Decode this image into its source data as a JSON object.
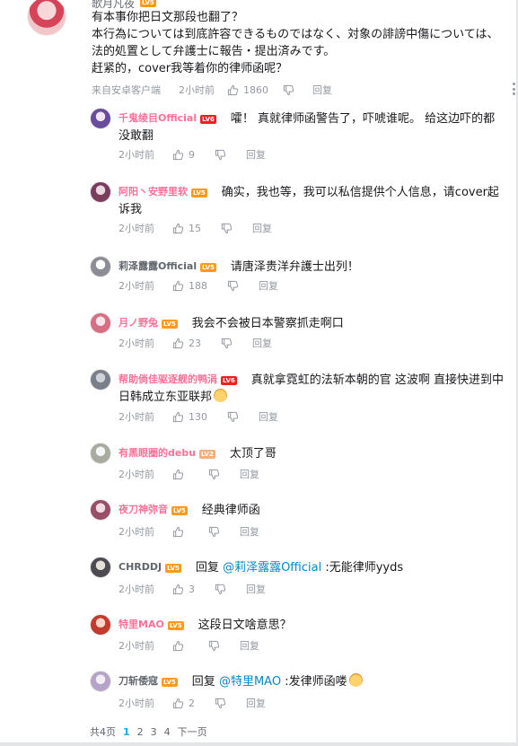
{
  "main_comment": {
    "username": "歌月凡夜",
    "level": "LV5",
    "lines": [
      "有本事你把日文那段也翻了？",
      "本行為については到底許容できるものではなく、対象の誹謗中傷については、",
      "法的処置として弁護士に報告・提出済みです。",
      "赶紧的，cover我等着你的律师函呢？"
    ],
    "source": "来自安卓客户端",
    "time": "2小时前",
    "likes": "1860",
    "reply_label": "回复"
  },
  "replies": [
    {
      "username": "千鬼绫目Official",
      "level": "LV6",
      "text": "嚯！ 真就律师函警告了，吓唬谁呢。 给这边吓的都没敢翻",
      "time": "2小时前",
      "likes": "9",
      "reply_label": "回复"
    },
    {
      "username": "阿阳丶安野里软",
      "level": "LV5",
      "text": "确实，我也等，我可以私信提供个人信息，请cover起诉我",
      "time": "2小时前",
      "likes": "15",
      "reply_label": "回复"
    },
    {
      "username": "莉泽露露Official",
      "level": "LV5",
      "text": "请唐泽贵洋弁護士出列！",
      "time": "2小时前",
      "likes": "188",
      "reply_label": "回复"
    },
    {
      "username": "月ノ野兔",
      "level": "LV5",
      "text": "我会不会被日本警察抓走啊口",
      "time": "2小时前",
      "likes": "23",
      "reply_label": "回复"
    },
    {
      "username": "帮助倘佳驱逐舰的鸭涓",
      "level": "LV6",
      "text": "真就拿霓虹的法斩本朝的官 这波啊 直接快进到中日韩成立东亚联邦",
      "time": "2小时前",
      "likes": "130",
      "reply_label": "回复"
    },
    {
      "username": "有黑眼圈的debu",
      "level": "LV2",
      "text": "太顶了哥",
      "time": "2小时前",
      "likes": "",
      "reply_label": "回复"
    },
    {
      "username": "夜刀神弥音",
      "level": "LV5",
      "text": "经典律师函",
      "time": "2小时前",
      "likes": "",
      "reply_label": "回复"
    },
    {
      "username": "CHRDDJ",
      "level": "LV5",
      "reply_word": "回复",
      "mention": "@莉泽露露Official",
      "text": ":无能律师yyds",
      "time": "2小时前",
      "likes": "3",
      "reply_label": "回复"
    },
    {
      "username": "特里MAO",
      "level": "LV5",
      "text": "这段日文啥意思？",
      "time": "2小时前",
      "likes": "",
      "reply_label": "回复"
    },
    {
      "username": "刀斩倭寇",
      "level": "LV5",
      "reply_word": "回复",
      "mention": "@特里MAO",
      "text": ":发律师函喽",
      "time": "2小时前",
      "likes": "2",
      "reply_label": "回复"
    }
  ],
  "pagination": {
    "total": "共4页",
    "pages": [
      "1",
      "2",
      "3",
      "4"
    ],
    "current": "1",
    "next": "下一页"
  },
  "colors": {
    "vip_name": "#fb7299",
    "normal_name": "#61666d",
    "mention": "#008ac5",
    "meta": "#9499a0",
    "page_current": "#00aeec"
  },
  "icons": [
    "thumb-up-icon",
    "thumb-down-icon",
    "more-icon",
    "emoji-icon"
  ]
}
